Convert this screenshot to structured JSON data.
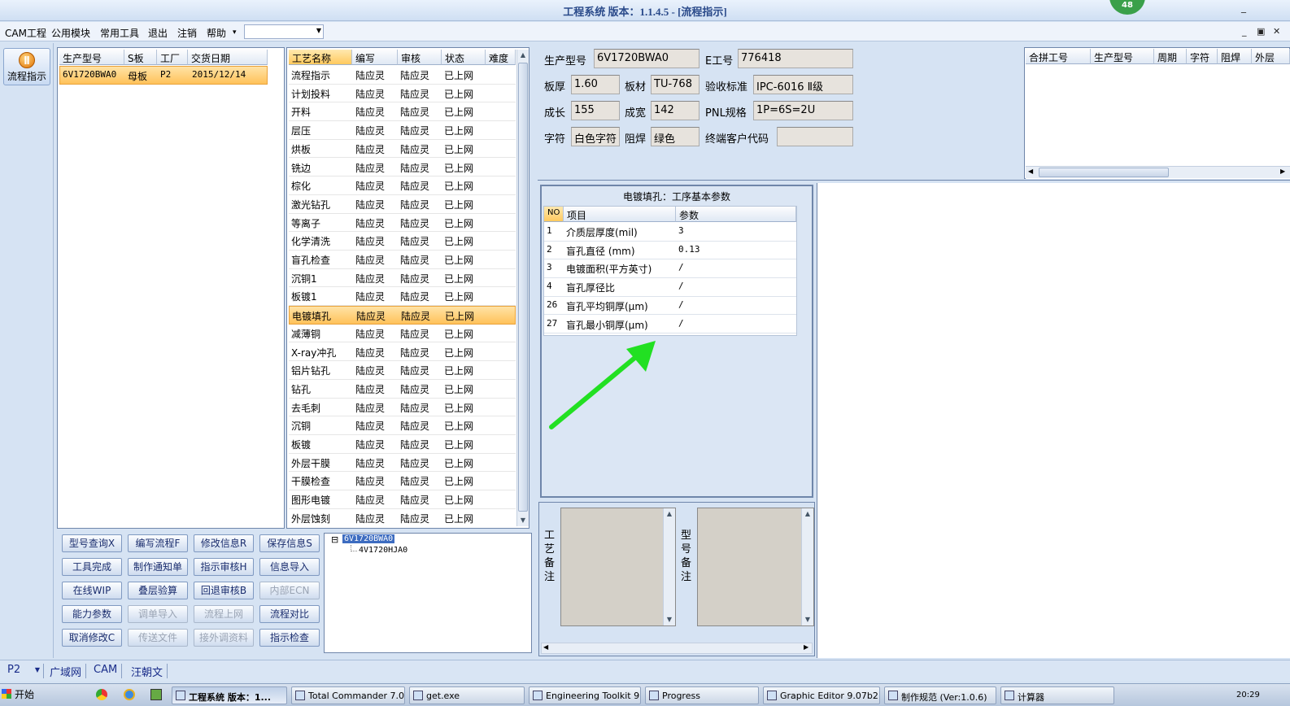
{
  "window": {
    "title": "工程系统  版本：1.1.4.5 - [流程指示]",
    "badge": "48",
    "min_symbol": "_"
  },
  "menu": {
    "items": [
      "CAM工程",
      "公用模块",
      "常用工具",
      "退出",
      "注销",
      "帮助",
      "▾"
    ],
    "combo_value": "",
    "mdi_controls": [
      "_",
      "▣",
      "✕"
    ]
  },
  "nav": {
    "button_label": "流程指示"
  },
  "orders": {
    "headers": [
      "生产型号",
      "S板",
      "工厂",
      "交货日期"
    ],
    "rows": [
      [
        "6V1720BWA0",
        "母板",
        "P2",
        "2015/12/14"
      ]
    ]
  },
  "process": {
    "headers": [
      "工艺名称",
      "编写",
      "审核",
      "状态",
      "难度"
    ],
    "selected_index": 13,
    "rows": [
      [
        "流程指示",
        "陆应灵",
        "陆应灵",
        "已上网",
        ""
      ],
      [
        "计划投料",
        "陆应灵",
        "陆应灵",
        "已上网",
        ""
      ],
      [
        "开料",
        "陆应灵",
        "陆应灵",
        "已上网",
        ""
      ],
      [
        "层压",
        "陆应灵",
        "陆应灵",
        "已上网",
        ""
      ],
      [
        "烘板",
        "陆应灵",
        "陆应灵",
        "已上网",
        ""
      ],
      [
        "铣边",
        "陆应灵",
        "陆应灵",
        "已上网",
        ""
      ],
      [
        "棕化",
        "陆应灵",
        "陆应灵",
        "已上网",
        ""
      ],
      [
        "激光钻孔",
        "陆应灵",
        "陆应灵",
        "已上网",
        ""
      ],
      [
        "等离子",
        "陆应灵",
        "陆应灵",
        "已上网",
        ""
      ],
      [
        "化学清洗",
        "陆应灵",
        "陆应灵",
        "已上网",
        ""
      ],
      [
        "盲孔检查",
        "陆应灵",
        "陆应灵",
        "已上网",
        ""
      ],
      [
        "沉铜1",
        "陆应灵",
        "陆应灵",
        "已上网",
        ""
      ],
      [
        "板镀1",
        "陆应灵",
        "陆应灵",
        "已上网",
        ""
      ],
      [
        "电镀填孔",
        "陆应灵",
        "陆应灵",
        "已上网",
        ""
      ],
      [
        "减薄铜",
        "陆应灵",
        "陆应灵",
        "已上网",
        ""
      ],
      [
        "X-ray冲孔",
        "陆应灵",
        "陆应灵",
        "已上网",
        ""
      ],
      [
        "铝片钻孔",
        "陆应灵",
        "陆应灵",
        "已上网",
        ""
      ],
      [
        "钻孔",
        "陆应灵",
        "陆应灵",
        "已上网",
        ""
      ],
      [
        "去毛刺",
        "陆应灵",
        "陆应灵",
        "已上网",
        ""
      ],
      [
        "沉铜",
        "陆应灵",
        "陆应灵",
        "已上网",
        ""
      ],
      [
        "板镀",
        "陆应灵",
        "陆应灵",
        "已上网",
        ""
      ],
      [
        "外层干膜",
        "陆应灵",
        "陆应灵",
        "已上网",
        ""
      ],
      [
        "干膜检查",
        "陆应灵",
        "陆应灵",
        "已上网",
        ""
      ],
      [
        "图形电镀",
        "陆应灵",
        "陆应灵",
        "已上网",
        ""
      ],
      [
        "外层蚀刻",
        "陆应灵",
        "陆应灵",
        "已上网",
        ""
      ]
    ]
  },
  "buttons": [
    [
      {
        "label": "型号查询X",
        "enabled": true
      },
      {
        "label": "编写流程F",
        "enabled": true
      },
      {
        "label": "修改信息R",
        "enabled": true
      },
      {
        "label": "保存信息S",
        "enabled": true
      }
    ],
    [
      {
        "label": "工具完成",
        "enabled": true
      },
      {
        "label": "制作通知单",
        "enabled": true
      },
      {
        "label": "指示审核H",
        "enabled": true
      },
      {
        "label": "信息导入",
        "enabled": true
      }
    ],
    [
      {
        "label": "在线WIP",
        "enabled": true
      },
      {
        "label": "叠层验算",
        "enabled": true
      },
      {
        "label": "回退审核B",
        "enabled": true
      },
      {
        "label": "内部ECN",
        "enabled": false
      }
    ],
    [
      {
        "label": "能力参数",
        "enabled": true
      },
      {
        "label": "调单导入",
        "enabled": false
      },
      {
        "label": "流程上网",
        "enabled": false
      },
      {
        "label": "流程对比",
        "enabled": true
      }
    ],
    [
      {
        "label": "取消修改C",
        "enabled": true
      },
      {
        "label": "传送文件",
        "enabled": false
      },
      {
        "label": "接外调资料",
        "enabled": false
      },
      {
        "label": "指示检查",
        "enabled": true
      }
    ]
  ],
  "tree": {
    "expander": "⊟",
    "root": "6V1720BWA0",
    "child": "4V1720HJA0"
  },
  "info": {
    "fields": [
      {
        "label": "生产型号",
        "value": "6V1720BWA0"
      },
      {
        "label": "E工号",
        "value": "776418"
      },
      {
        "label": "板厚",
        "value": "1.60"
      },
      {
        "label": "板材",
        "value": "TU-768"
      },
      {
        "label": "验收标准",
        "value": "IPC-6016 Ⅱ级"
      },
      {
        "label": "成长",
        "value": "155"
      },
      {
        "label": "成宽",
        "value": "142"
      },
      {
        "label": "PNL规格",
        "value": "1P=6S=2U"
      },
      {
        "label": "字符",
        "value": "白色字符"
      },
      {
        "label": "阻焊",
        "value": "绿色"
      },
      {
        "label": "终端客户代码",
        "value": ""
      }
    ]
  },
  "merge": {
    "headers": [
      "合拼工号",
      "生产型号",
      "周期",
      "字符",
      "阻焊",
      "外层"
    ]
  },
  "params": {
    "title": "电镀填孔：工序基本参数",
    "headers": [
      "NO",
      "项目",
      "参数"
    ],
    "rows": [
      [
        "1",
        "介质层厚度(mil)",
        "3"
      ],
      [
        "2",
        "盲孔直径 (mm)",
        "0.13"
      ],
      [
        "3",
        "电镀面积(平方英寸)",
        "/"
      ],
      [
        "4",
        "盲孔厚径比",
        "/"
      ],
      [
        "26",
        "盲孔平均铜厚(μm)",
        "/"
      ],
      [
        "27",
        "盲孔最小铜厚(μm)",
        "/"
      ]
    ]
  },
  "notes": {
    "process_label": "工艺备注",
    "model_label": "型号备注"
  },
  "status": {
    "factory": "P2",
    "tabs": [
      "广域网",
      "CAM",
      "汪朝文"
    ]
  },
  "taskbar": {
    "start": "开始",
    "tasks": [
      "工程系统  版本：1...",
      "Total Commander 7.0 ...",
      "get.exe",
      "Engineering Toolkit 9....",
      "Progress",
      "Graphic Editor 9.07b2...",
      "制作规范 (Ver:1.0.6)",
      "计算器"
    ],
    "clock": "20:29"
  },
  "colors": {
    "accent": "#ffc25a",
    "arrow": "#22e022",
    "link_text": "#1a2d8a"
  }
}
